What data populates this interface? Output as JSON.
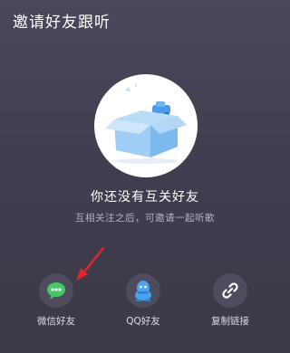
{
  "dialog": {
    "title": "邀请好友跟听"
  },
  "empty_state": {
    "title": "你还没有互关好友",
    "subtitle": "互相关注之后，可邀请一起听歌"
  },
  "share_options": [
    {
      "label": "微信好友",
      "icon": "wechat-icon"
    },
    {
      "label": "QQ好友",
      "icon": "qq-icon"
    },
    {
      "label": "复制链接",
      "icon": "link-icon"
    }
  ],
  "colors": {
    "background": "#433f50",
    "wechat_green": "#44c767",
    "qq_blue": "#4aa3f0",
    "annotation_red": "#e3242b",
    "box_blue": "#8cc6f3"
  }
}
